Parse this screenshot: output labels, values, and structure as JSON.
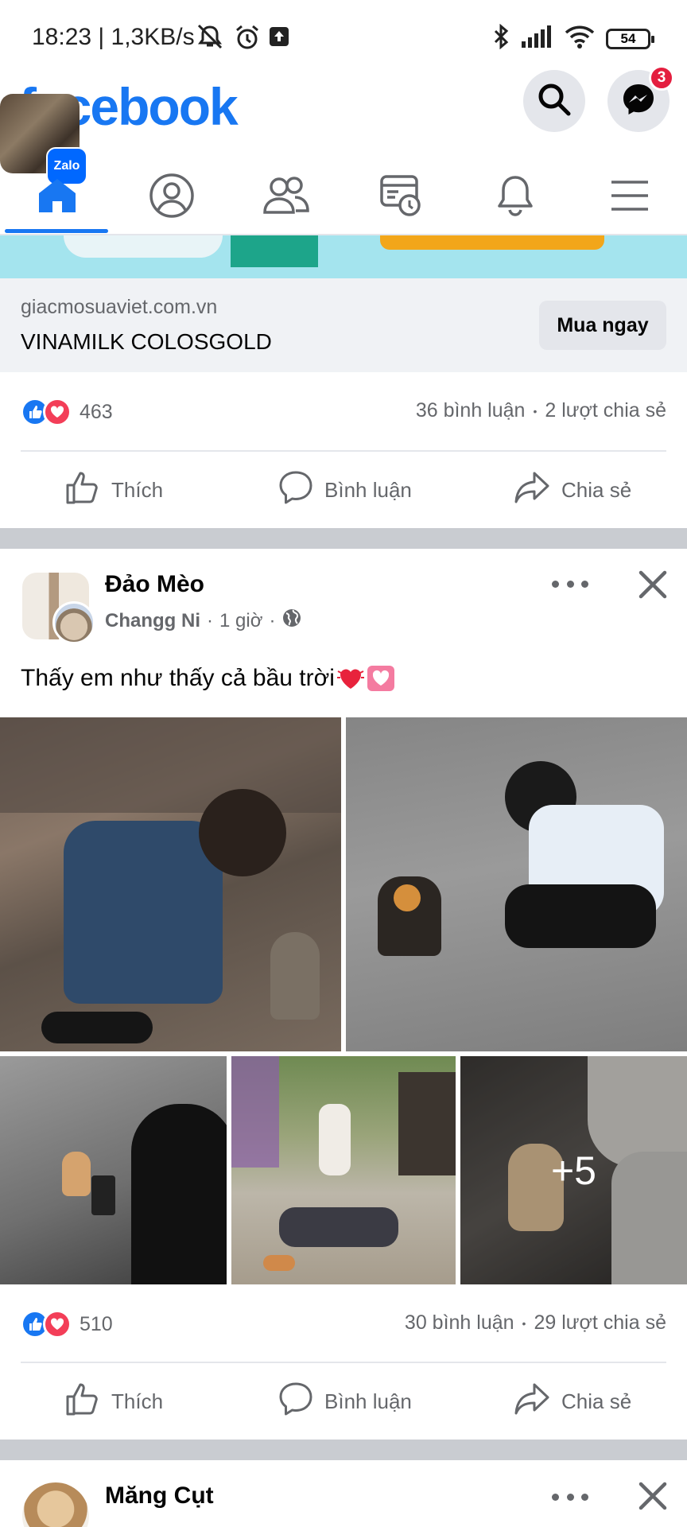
{
  "status_bar": {
    "time_speed": "18:23 | 1,3KB/s",
    "battery": "54"
  },
  "header": {
    "logo": "facebook",
    "messenger_badge": "3",
    "zalo_label": "Zalo"
  },
  "nav": {
    "tabs": [
      "home-icon",
      "profile-icon",
      "friends-icon",
      "feeds-icon",
      "notifications-icon",
      "menu-icon"
    ],
    "active_index": 0
  },
  "ad": {
    "domain": "giacmosuaviet.com.vn",
    "title": "VINAMILK COLOSGOLD",
    "cta": "Mua ngay",
    "reactions_count": "463",
    "comments": "36 bình luận",
    "shares": "2 lượt chia sẻ"
  },
  "actions": {
    "like": "Thích",
    "comment": "Bình luận",
    "share": "Chia sẻ"
  },
  "post1": {
    "group": "Đảo Mèo",
    "author": "Changg Ni",
    "time": "1 giờ",
    "text": "Thấy em như thấy cả bầu trời",
    "more_photos": "+5",
    "reactions_count": "510",
    "comments": "30 bình luận",
    "shares": "29 lượt chia sẻ"
  },
  "post2": {
    "group": "Măng Cụt"
  },
  "colors": {
    "brand": "#1877f2",
    "like": "#1877f2",
    "love": "#f33e58",
    "badge": "#e41e3f"
  }
}
